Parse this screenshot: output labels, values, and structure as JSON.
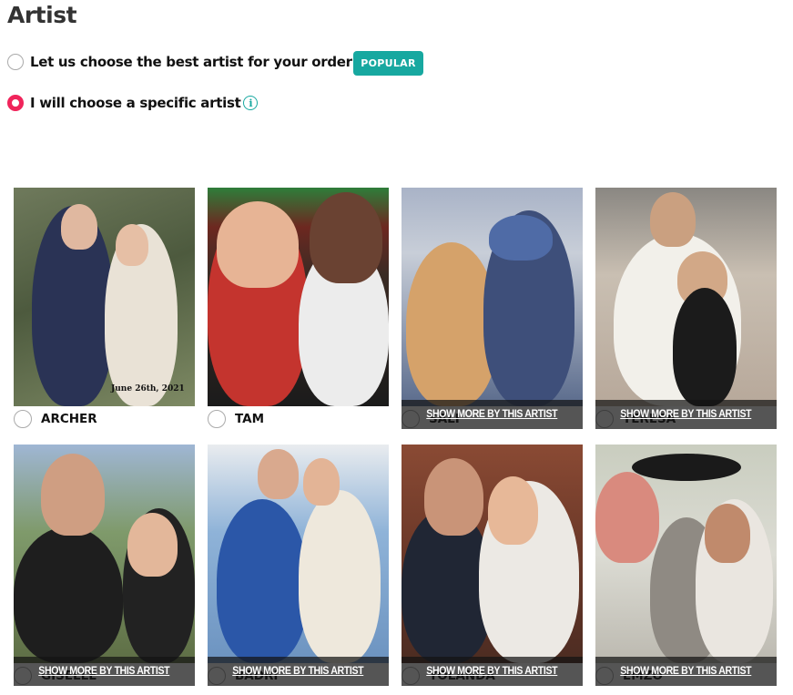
{
  "section": {
    "title": "Artist"
  },
  "options": [
    {
      "label": "Let us choose the best artist for your order",
      "selected": false,
      "badge": "POPULAR"
    },
    {
      "label": "I will choose a specific artist",
      "selected": true,
      "info_icon": "info-icon"
    }
  ],
  "artist_grid": {
    "show_more_label": "SHOW MORE BY THIS ARTIST",
    "artists": [
      {
        "name": "ARCHER",
        "selected": false,
        "show_more_visible": false,
        "image_caption": "June 26th, 2021"
      },
      {
        "name": "TAM",
        "selected": false,
        "show_more_visible": false
      },
      {
        "name": "SALI",
        "selected": false,
        "show_more_visible": true
      },
      {
        "name": "TERESA",
        "selected": false,
        "show_more_visible": true
      },
      {
        "name": "GISELLE",
        "selected": false,
        "show_more_visible": true
      },
      {
        "name": "BADRI",
        "selected": false,
        "show_more_visible": true
      },
      {
        "name": "YOLANDA",
        "selected": false,
        "show_more_visible": true
      },
      {
        "name": "EMZO",
        "selected": false,
        "show_more_visible": true
      }
    ]
  },
  "colors": {
    "accent_teal": "#17a8a0",
    "radio_selected": "#f0245b"
  }
}
